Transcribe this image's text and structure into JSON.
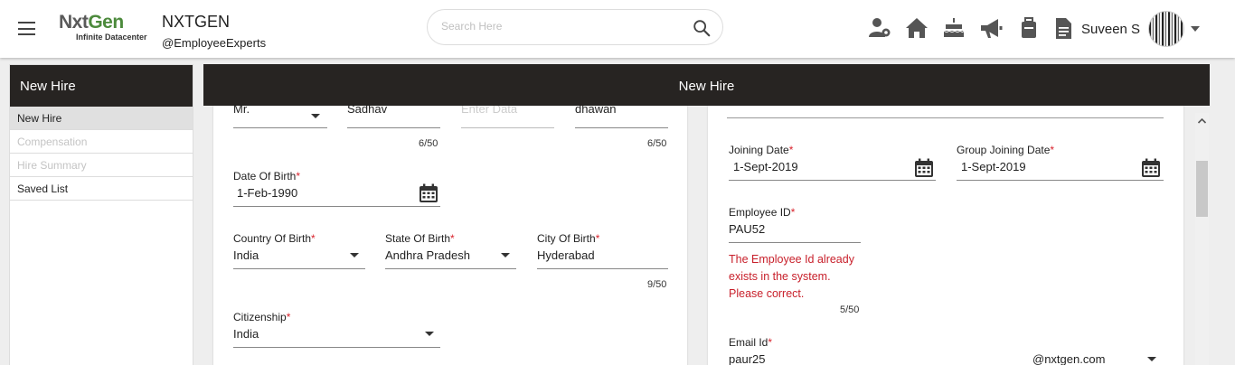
{
  "header": {
    "logo_text_a": "Nxt",
    "logo_text_b": "Gen",
    "logo_tagline": "Infinite Datacenter",
    "brand_name": "NXTGEN",
    "brand_handle": "@EmployeeExperts",
    "search_placeholder": "Search Here",
    "user_name": "Suveen S",
    "icons": [
      "team-icon",
      "home-icon",
      "celebration-cake-icon",
      "announcement-megaphone-icon",
      "briefcase-icon",
      "document-icon"
    ]
  },
  "sidebar": {
    "title": "New Hire",
    "items": [
      {
        "label": "New Hire",
        "state": "active"
      },
      {
        "label": "Compensation",
        "state": "disabled"
      },
      {
        "label": "Hire Summary",
        "state": "disabled"
      },
      {
        "label": "Saved List",
        "state": "enabled"
      }
    ]
  },
  "main": {
    "title": "New Hire"
  },
  "left_form": {
    "salutation": "Mr.",
    "first_name": "Sadhav",
    "middle_name_placeholder": "Enter Data",
    "last_name": "dhawan",
    "first_name_count": "6/50",
    "last_name_count": "6/50",
    "dob_label": "Date Of Birth",
    "dob_value": "1-Feb-1990",
    "country_label": "Country Of Birth",
    "country_value": "India",
    "state_label": "State Of Birth",
    "state_value": "Andhra Pradesh",
    "city_label": "City Of Birth",
    "city_value": "Hyderabad",
    "city_count": "9/50",
    "citizenship_label": "Citizenship",
    "citizenship_value": "India",
    "required_mark": "*"
  },
  "right_form": {
    "joining_label": "Joining Date",
    "joining_value": "1-Sept-2019",
    "group_joining_label": "Group Joining Date",
    "group_joining_value": "1-Sept-2019",
    "employee_id_label": "Employee ID",
    "employee_id_value": "PAU52",
    "employee_id_error_1": "The Employee Id already",
    "employee_id_error_2": "exists in the system.",
    "employee_id_error_3": "Please correct.",
    "employee_id_count": "5/50",
    "email_label": "Email Id",
    "email_value": "paur25",
    "email_domain": "@nxtgen.com"
  },
  "colors": {
    "header_dark": "#272422",
    "required": "#d9232d",
    "error": "#c8202b",
    "logo_green": "#4c8a3c"
  }
}
